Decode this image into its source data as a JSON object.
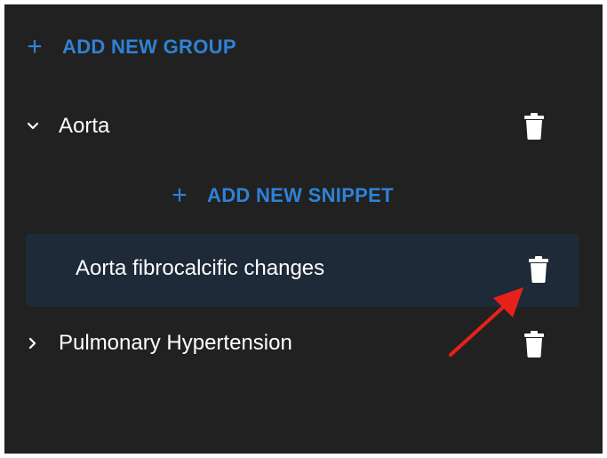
{
  "add_group": {
    "icon": "plus-icon",
    "label": "ADD NEW GROUP"
  },
  "groups": [
    {
      "label": "Aorta",
      "expanded": true,
      "chevron": "chevron-down-icon",
      "delete_icon": "trash-icon",
      "add_snippet": {
        "icon": "plus-icon",
        "label": "ADD NEW SNIPPET"
      },
      "snippets": [
        {
          "label": "Aorta fibrocalcific changes",
          "delete_icon": "trash-icon",
          "selected": true
        }
      ]
    },
    {
      "label": "Pulmonary Hypertension",
      "expanded": false,
      "chevron": "chevron-right-icon",
      "delete_icon": "trash-icon"
    }
  ],
  "colors": {
    "background": "#212121",
    "accent": "#2f82d6",
    "selected_row": "#1e2a38",
    "text": "#ffffff",
    "annotation_arrow": "#e8201a"
  },
  "annotation": {
    "type": "arrow",
    "points_to": "snippet-delete-button"
  }
}
